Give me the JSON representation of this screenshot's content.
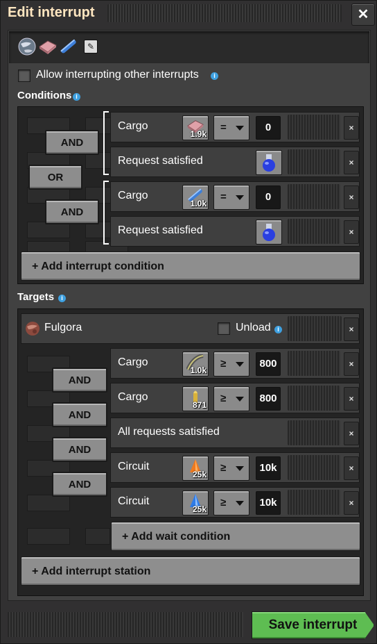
{
  "window": {
    "title": "Edit interrupt",
    "close_icon": "close-icon"
  },
  "icons": [
    "planet-icon",
    "tile-item-icon",
    "blue-rod-icon",
    "edit-pencil-icon"
  ],
  "allow_interrupting": {
    "label": "Allow interrupting other interrupts",
    "checked": false
  },
  "conditions": {
    "title": "Conditions",
    "or_label": "OR",
    "groups": [
      {
        "and_label": "AND",
        "rows": [
          {
            "kind": "Cargo",
            "icon": "tile-item-icon",
            "qty": "1.9k",
            "comparator": "=",
            "value": "0",
            "remove": "×"
          },
          {
            "kind": "Request satisfied",
            "icon": "blue-flask-icon",
            "remove": "×"
          }
        ]
      },
      {
        "and_label": "AND",
        "rows": [
          {
            "kind": "Cargo",
            "icon": "blue-rod-icon",
            "qty": "1.0k",
            "comparator": "=",
            "value": "0",
            "remove": "×"
          },
          {
            "kind": "Request satisfied",
            "icon": "blue-flask-icon",
            "remove": "×"
          }
        ]
      }
    ],
    "add_label": "+ Add interrupt condition"
  },
  "targets": {
    "title": "Targets",
    "station": {
      "name": "Fulgora",
      "unload_label": "Unload",
      "unload_checked": false,
      "remove": "×"
    },
    "and_labels": [
      "AND",
      "AND",
      "AND",
      "AND"
    ],
    "rows": [
      {
        "kind": "Cargo",
        "icon": "rail-icon",
        "qty": "1.0k",
        "comparator": "≥",
        "value": "800",
        "remove": "×"
      },
      {
        "kind": "Cargo",
        "icon": "yellow-bullet-icon",
        "qty": "871",
        "comparator": "≥",
        "value": "800",
        "remove": "×"
      },
      {
        "kind": "All requests satisfied",
        "remove": "×"
      },
      {
        "kind": "Circuit",
        "icon": "orange-signal-icon",
        "qty": "25k",
        "comparator": "≥",
        "value": "10k",
        "remove": "×"
      },
      {
        "kind": "Circuit",
        "icon": "blue-signal-icon",
        "qty": "25k",
        "comparator": "≥",
        "value": "10k",
        "remove": "×"
      }
    ],
    "add_wait_label": "+ Add wait condition",
    "add_station_label": "+ Add interrupt station"
  },
  "save_label": "Save interrupt",
  "colors": {
    "title": "#ffe6c0",
    "save": "#5ebd52",
    "info": "#3ea0e0"
  }
}
